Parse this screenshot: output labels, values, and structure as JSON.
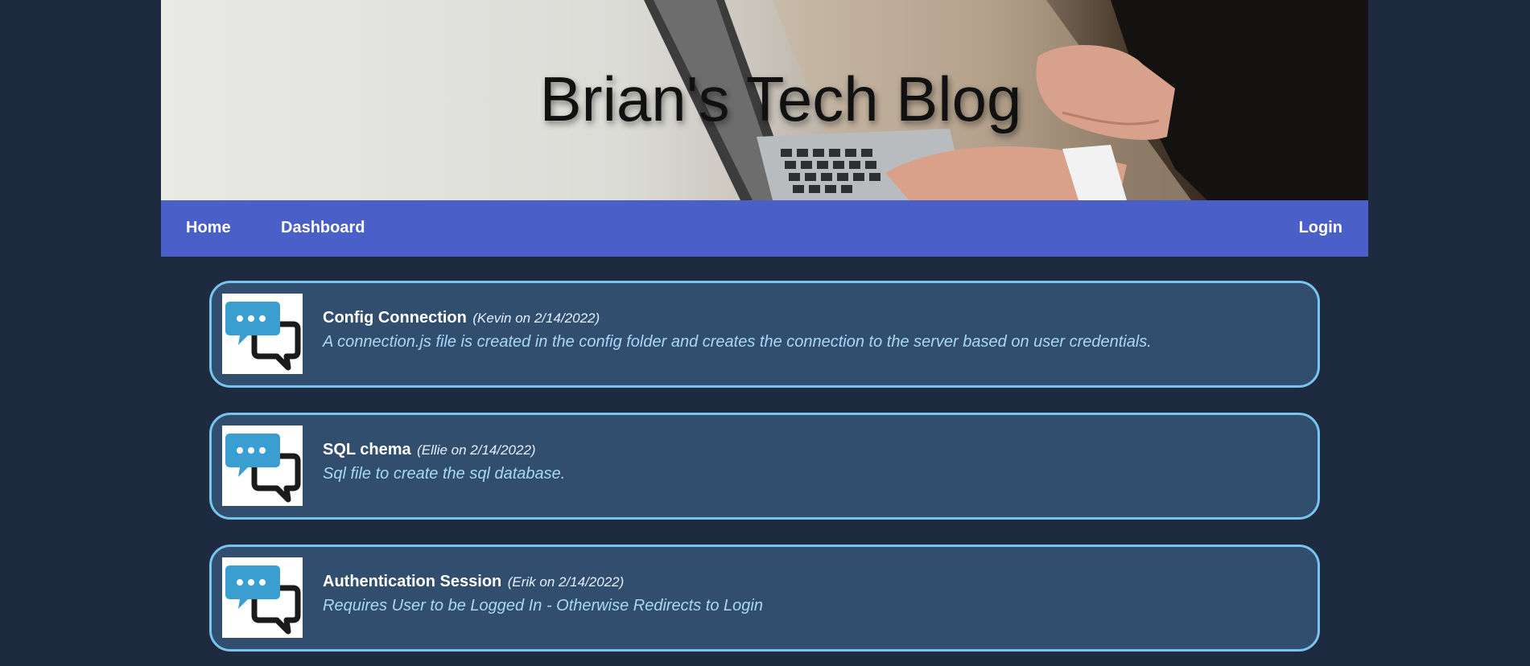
{
  "header": {
    "title": "Brian's Tech Blog"
  },
  "nav": {
    "home": "Home",
    "dashboard": "Dashboard",
    "login": "Login"
  },
  "posts": [
    {
      "title": "Config Connection",
      "meta": "(Kevin on 2/14/2022)",
      "body": "A connection.js file is created in the config folder and creates the connection to the server based on user credentials.",
      "icon": "chat-bubbles-icon"
    },
    {
      "title": "SQL chema",
      "meta": "(Ellie on 2/14/2022)",
      "body": "Sql file to create the sql database.",
      "icon": "chat-bubbles-icon"
    },
    {
      "title": "Authentication Session",
      "meta": "(Erik on 2/14/2022)",
      "body": "Requires User to be Logged In - Otherwise Redirects to Login",
      "icon": "chat-bubbles-icon"
    }
  ],
  "colors": {
    "background": "#1d2a3f",
    "navbar": "#4a5fc7",
    "post_background": "#324e6e",
    "post_border": "#77c4ee",
    "post_body_text": "#a9d8f6",
    "icon_bubble": "#3a9fd0"
  }
}
